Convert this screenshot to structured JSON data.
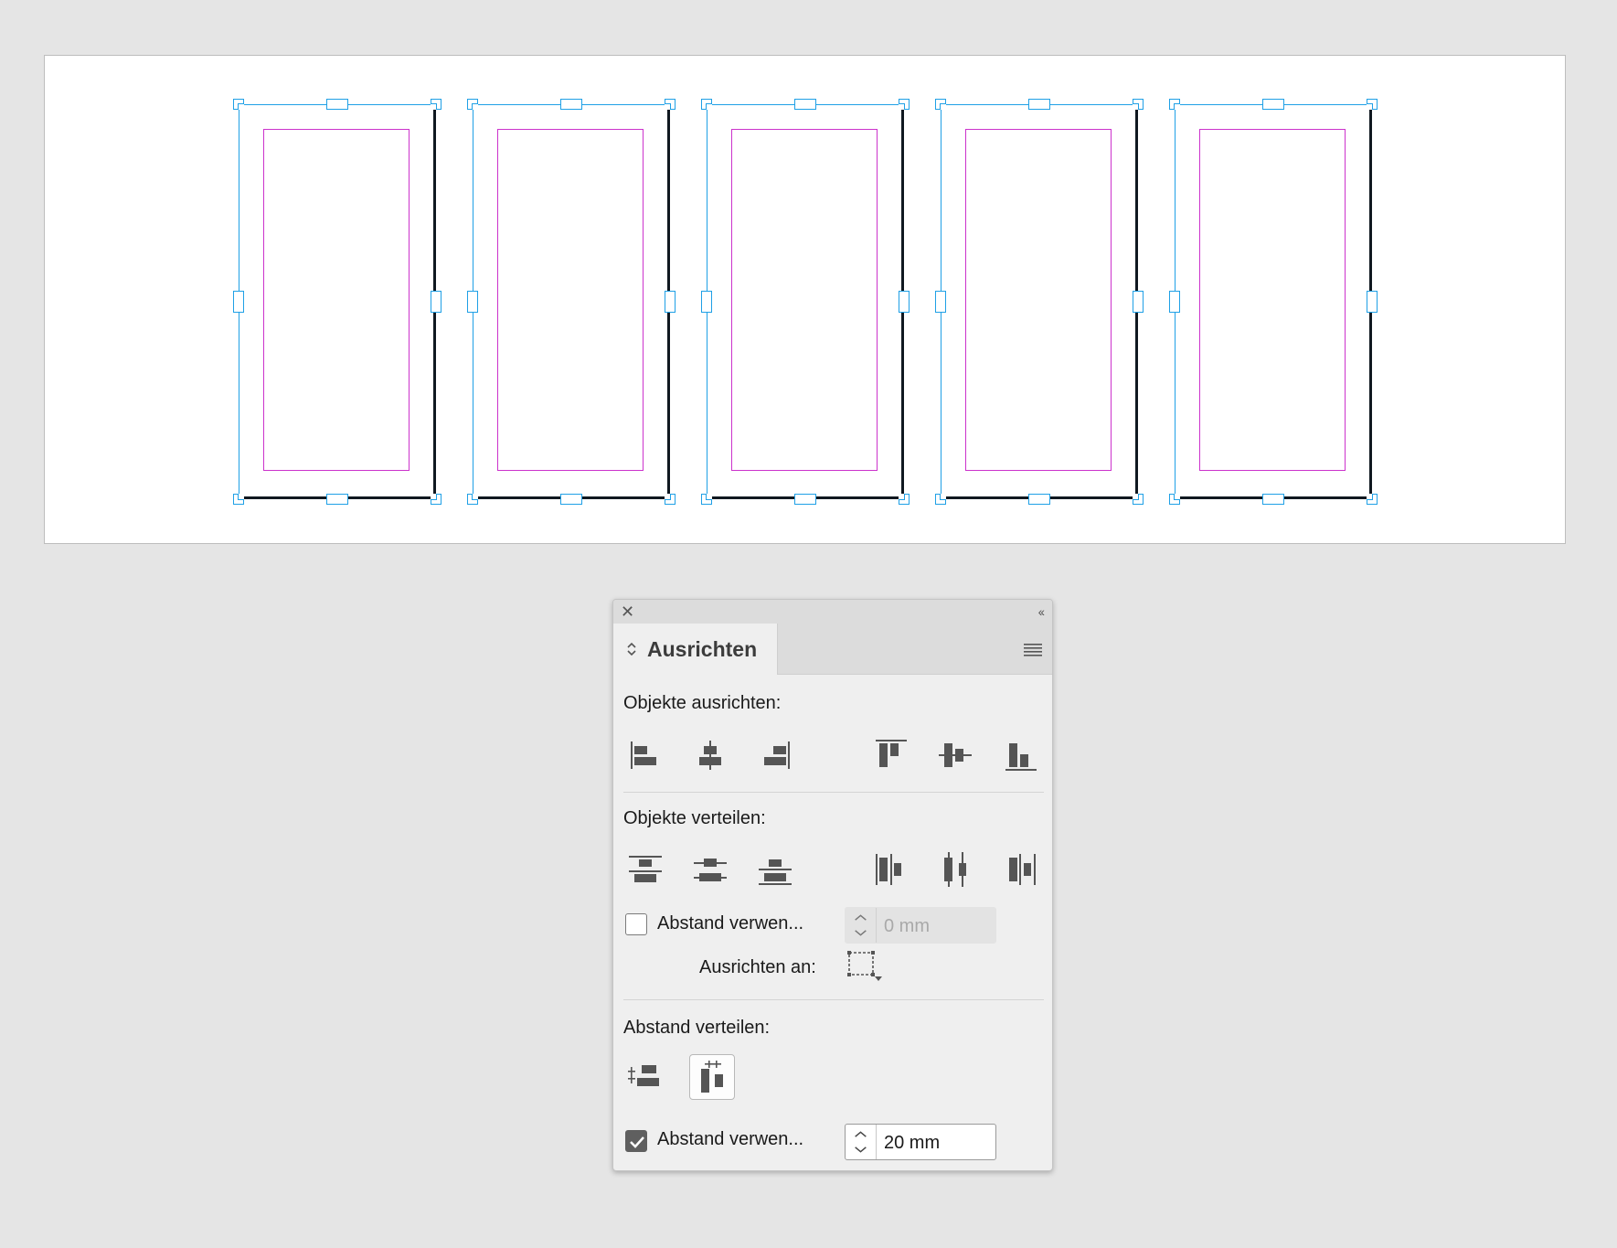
{
  "document": {
    "page_count": 5
  },
  "panel": {
    "title": "Ausrichten",
    "close_icon": "close-icon",
    "collapse_icon": "collapse-double-chevron-icon",
    "menu_icon": "panel-menu-icon",
    "align_objects": {
      "label": "Objekte ausrichten:",
      "buttons": [
        "align-left-edges-icon",
        "align-horizontal-centers-icon",
        "align-right-edges-icon",
        "align-top-edges-icon",
        "align-vertical-centers-icon",
        "align-bottom-edges-icon"
      ]
    },
    "distribute_objects": {
      "label": "Objekte verteilen:",
      "buttons": [
        "distribute-top-edges-icon",
        "distribute-vertical-centers-icon",
        "distribute-bottom-edges-icon",
        "distribute-left-edges-icon",
        "distribute-horizontal-centers-icon",
        "distribute-right-edges-icon"
      ],
      "use_spacing_label": "Abstand verwen...",
      "use_spacing_checked": false,
      "spacing_value": "0 mm",
      "align_to_label": "Ausrichten an:",
      "align_to_icon": "align-to-selection-icon"
    },
    "distribute_spacing": {
      "label": "Abstand verteilen:",
      "buttons": [
        "distribute-vertical-space-icon",
        "distribute-horizontal-space-icon"
      ],
      "selected": "distribute-horizontal-space-icon",
      "use_spacing_label": "Abstand verwen...",
      "use_spacing_checked": true,
      "spacing_value": "20 mm"
    }
  },
  "colors": {
    "selection": "#1fa0e6",
    "margin_guide": "#cc33cc",
    "page_shadow": "#101820",
    "panel_bg": "#efefef",
    "icon": "#555555"
  }
}
